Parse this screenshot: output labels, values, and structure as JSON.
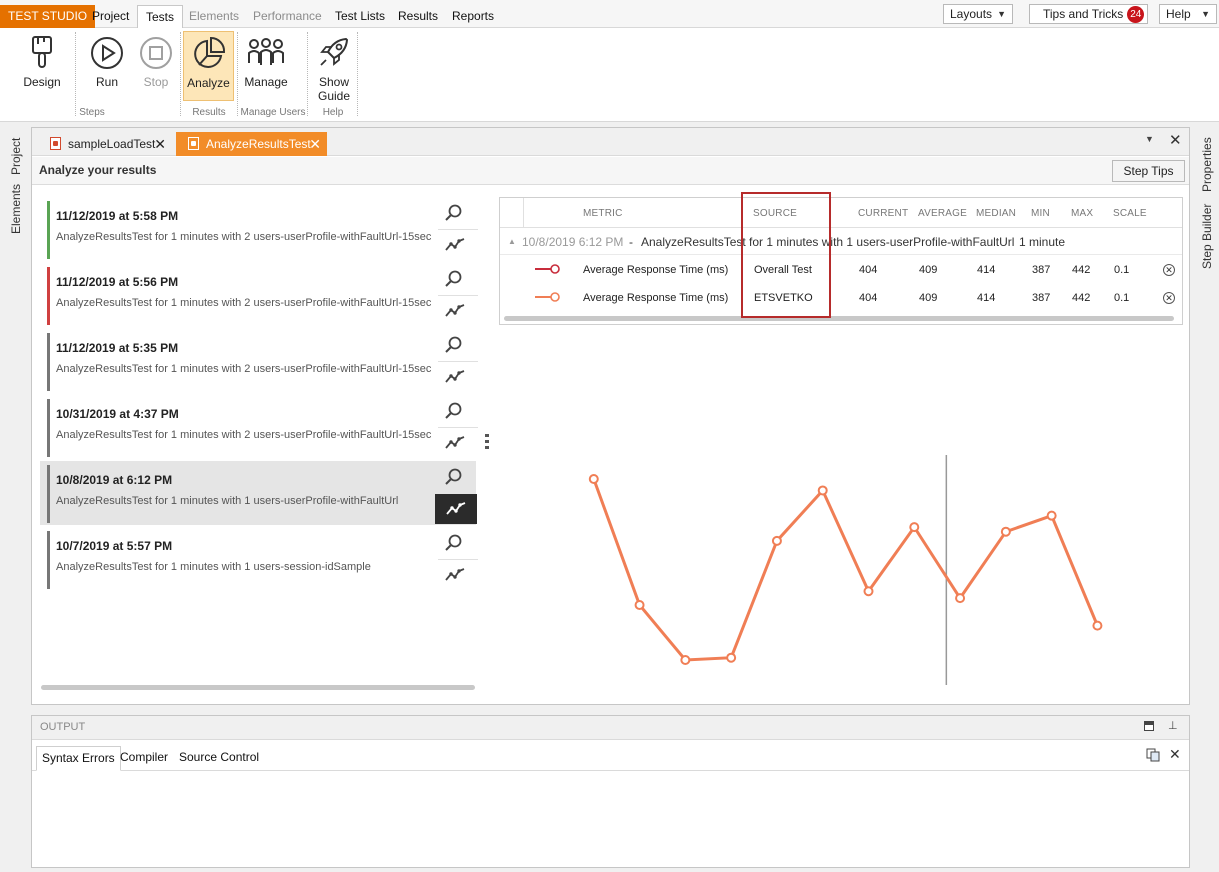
{
  "app": {
    "brand": "TEST STUDIO"
  },
  "menu": {
    "tabs": [
      {
        "label": "Project"
      },
      {
        "label": "Tests"
      },
      {
        "label": "Elements"
      },
      {
        "label": "Performance"
      },
      {
        "label": "Test Lists"
      },
      {
        "label": "Results"
      },
      {
        "label": "Reports"
      }
    ],
    "layouts": "Layouts",
    "tips": "Tips and Tricks",
    "tips_count": "24",
    "help": "Help"
  },
  "ribbon": {
    "buttons": [
      {
        "label": "Design",
        "icon": "brush-icon"
      },
      {
        "label": "Run",
        "icon": "play-icon"
      },
      {
        "label": "Stop",
        "icon": "stop-icon"
      },
      {
        "label": "Analyze",
        "icon": "pie-chart-icon"
      },
      {
        "label": "Manage",
        "icon": "users-icon"
      },
      {
        "label": "Show",
        "label2": "Guide",
        "icon": "rocket-icon"
      }
    ],
    "groups": [
      "Steps",
      "Results",
      "Manage Users",
      "Help"
    ]
  },
  "rails": {
    "left": [
      "Project",
      "Elements"
    ],
    "right": [
      "Properties",
      "Step Builder"
    ]
  },
  "doc_tabs": [
    {
      "label": "sampleLoadTest"
    },
    {
      "label": "AnalyzeResultsTest"
    }
  ],
  "subheader": {
    "title": "Analyze your results",
    "step_tips": "Step Tips"
  },
  "results": [
    {
      "date": "11/12/2019 at 5:58 PM",
      "desc": "AnalyzeResultsTest for 1 minutes with 2 users-userProfile-withFaultUrl-15sec",
      "status_color": "#5aa454"
    },
    {
      "date": "11/12/2019 at 5:56 PM",
      "desc": "AnalyzeResultsTest for 1 minutes with 2 users-userProfile-withFaultUrl-15sec",
      "status_color": "#d04040"
    },
    {
      "date": "11/12/2019 at 5:35 PM",
      "desc": "AnalyzeResultsTest for 1 minutes with 2 users-userProfile-withFaultUrl-15sec",
      "status_color": "#777777"
    },
    {
      "date": "10/31/2019 at 4:37 PM",
      "desc": "AnalyzeResultsTest for 1 minutes with 2 users-userProfile-withFaultUrl-15sec",
      "status_color": "#777777"
    },
    {
      "date": "10/8/2019 at 6:12 PM",
      "desc": "AnalyzeResultsTest for 1 minutes with 1 users-userProfile-withFaultUrl",
      "status_color": "#777777"
    },
    {
      "date": "10/7/2019 at 5:57 PM",
      "desc": "AnalyzeResultsTest for 1 minutes with 1 users-session-idSample",
      "status_color": "#777777"
    }
  ],
  "grid": {
    "columns": [
      "METRIC",
      "SOURCE",
      "CURRENT",
      "AVERAGE",
      "MEDIAN",
      "MIN",
      "MAX",
      "SCALE"
    ],
    "group": {
      "date": "10/8/2019 6:12 PM",
      "sep": "-",
      "name": "AnalyzeResultsTest for 1 minutes with 1 users-userProfile-withFaultUrl",
      "duration": "1 minute"
    },
    "rows": [
      {
        "metric": "Average Response Time (ms)",
        "source": "Overall Test",
        "current": "404",
        "average": "409",
        "median": "414",
        "min": "387",
        "max": "442",
        "scale": "0.1",
        "color": "#c82d3c"
      },
      {
        "metric": "Average Response Time (ms)",
        "source": "ETSVETKO",
        "current": "404",
        "average": "409",
        "median": "414",
        "min": "387",
        "max": "442",
        "scale": "0.1",
        "color": "#f07e55"
      }
    ]
  },
  "chart_data": {
    "type": "line",
    "x": [
      5,
      10,
      15,
      20,
      25,
      30,
      35,
      40,
      45,
      50,
      55,
      60
    ],
    "series": [
      {
        "values": [
          442,
          387,
          363,
          364,
          415,
          437,
          393,
          421,
          390,
          419,
          426,
          378
        ],
        "color": "#f07e55"
      }
    ],
    "xlim": [
      0,
      70
    ],
    "xticks": [
      0,
      10,
      20,
      30,
      40,
      50,
      60,
      70
    ],
    "ylim": [
      330,
      450
    ],
    "cursor_x": 43.5,
    "grid": false
  },
  "output": {
    "title": "OUTPUT",
    "tabs": [
      {
        "label": "Syntax Errors"
      },
      {
        "label": "Compiler"
      },
      {
        "label": "Source Control"
      }
    ]
  }
}
